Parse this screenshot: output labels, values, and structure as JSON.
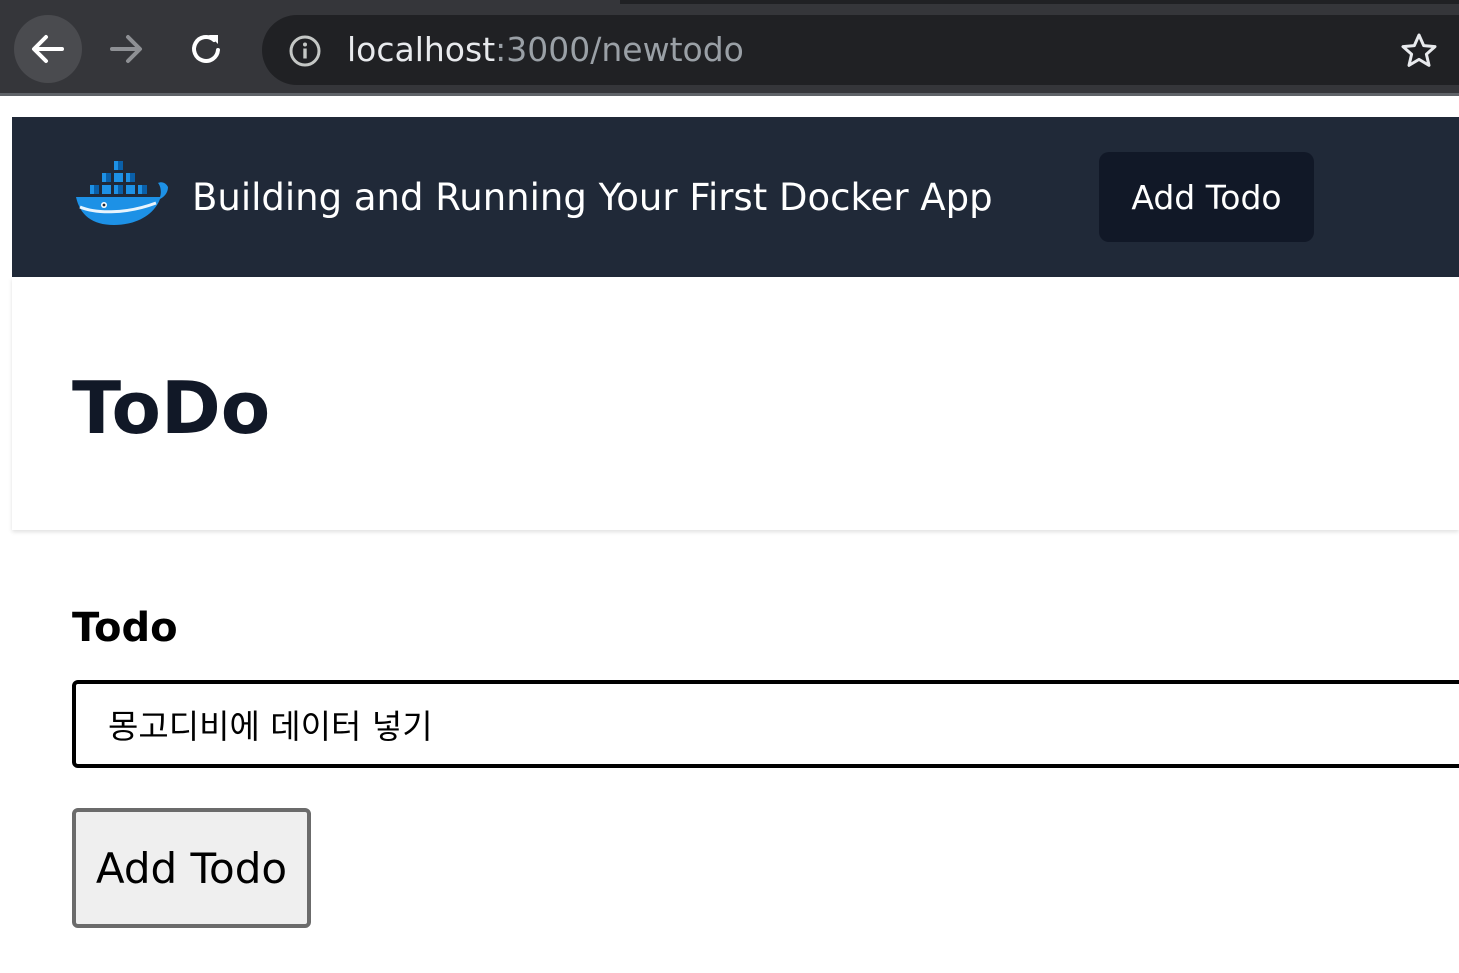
{
  "browser": {
    "url_host": "localhost",
    "url_path": ":3000/newtodo",
    "icons": {
      "back": "arrow-left-icon",
      "forward": "arrow-right-icon",
      "reload": "reload-icon",
      "site_info": "info-icon",
      "bookmark": "star-icon"
    }
  },
  "navbar": {
    "logo": "docker-whale-logo",
    "title": "Building and Running Your First Docker App",
    "add_todo_label": "Add Todo"
  },
  "header": {
    "title": "ToDo"
  },
  "form": {
    "label": "Todo",
    "input_value": "몽고디비에 데이터 넣기",
    "submit_label": "Add Todo"
  },
  "colors": {
    "browser_bg": "#35363a",
    "omnibox_bg": "#202124",
    "nav_bg": "#202938",
    "nav_button_bg": "#111827",
    "title_text": "#111827",
    "docker_blue": "#1d91e6"
  }
}
